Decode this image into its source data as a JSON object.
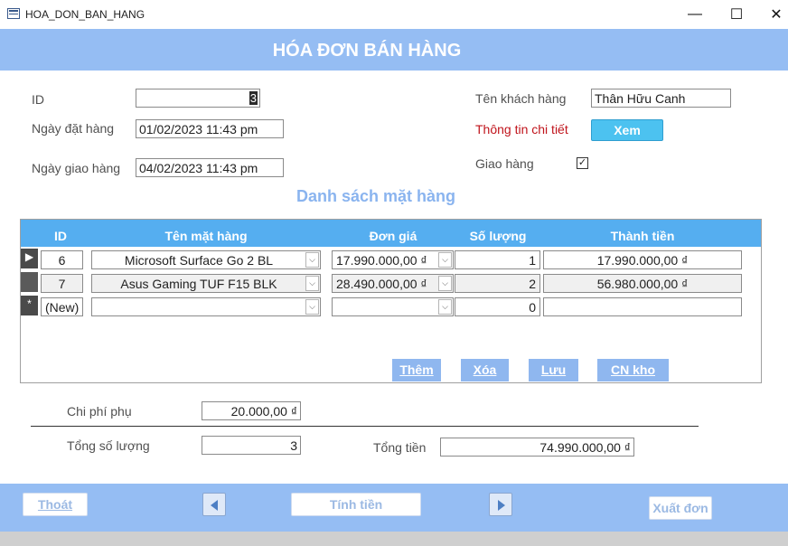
{
  "window": {
    "title": "HOA_DON_BAN_HANG",
    "minimize": "—",
    "maximize": "☐",
    "close": "✕"
  },
  "header": {
    "title": "HÓA ĐƠN BÁN HÀNG"
  },
  "order": {
    "id_label": "ID",
    "id_value": "3",
    "order_date_label": "Ngày đặt hàng",
    "order_date_value": "01/02/2023 11:43 pm",
    "ship_date_label": "Ngày giao hàng",
    "ship_date_value": "04/02/2023 11:43 pm",
    "customer_label": "Tên khách hàng",
    "customer_value": "Thân Hữu Canh",
    "details_label": "Thông tin chi tiết",
    "view_button": "Xem",
    "delivered_label": "Giao hàng",
    "delivered_checked": true,
    "check_glyph": "✓"
  },
  "items_section": {
    "title": "Danh sách mặt hàng",
    "columns": [
      "ID",
      "Tên mặt hàng",
      "Đơn giá",
      "Số lượng",
      "Thành tiền"
    ],
    "rows": [
      {
        "selector": "▶",
        "id": "6",
        "name": "Microsoft Surface Go 2 BL",
        "price": "17.990.000,00 ₫",
        "qty": "1",
        "total": "17.990.000,00 ₫"
      },
      {
        "selector": "",
        "id": "7",
        "name": "Asus Gaming TUF F15 BLK",
        "price": "28.490.000,00 ₫",
        "qty": "2",
        "total": "56.980.000,00 ₫"
      },
      {
        "selector": "*",
        "id": "(New)",
        "name": "",
        "price": "",
        "qty": "0",
        "total": ""
      }
    ],
    "dropdown_glyph": "⌵",
    "buttons": {
      "add": "Thêm",
      "delete": "Xóa",
      "save": "Lưu",
      "update_stock": "CN kho"
    }
  },
  "summary": {
    "extra_cost_label": "Chi phí phụ",
    "extra_cost_value": "20.000,00 ₫",
    "total_qty_label": "Tổng số lượng",
    "total_qty_value": "3",
    "total_amount_label": "Tổng tiền",
    "total_amount_value": "74.990.000,00 ₫"
  },
  "footer": {
    "exit": "Thoát",
    "calculate": "Tính tiền",
    "export": "Xuất đơn"
  },
  "colors": {
    "band": "#95bdf3",
    "grid_header": "#55aef0",
    "accent_button": "#4cc2f0",
    "label_red": "#c0141c"
  }
}
